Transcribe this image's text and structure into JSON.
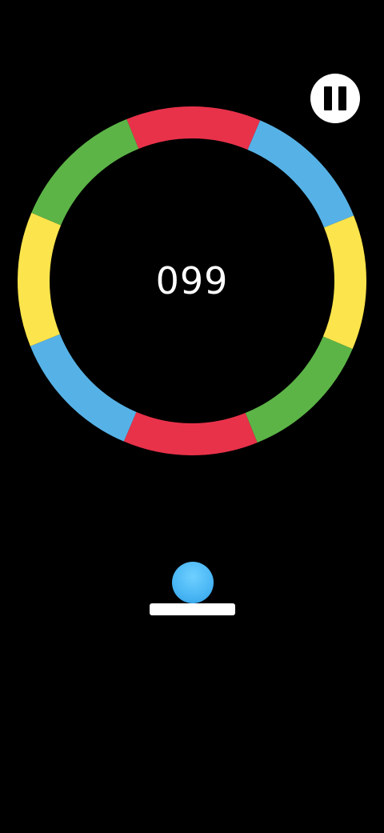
{
  "game": {
    "score": "099",
    "colors": {
      "background": "#000000",
      "red": "#e8324a",
      "blue": "#56b2e6",
      "yellow": "#fce44c",
      "green": "#5cb447",
      "ball": "#4cb8f5",
      "platform": "#ffffff"
    },
    "ring": {
      "segment_order_clockwise_from_top": [
        "red",
        "blue",
        "yellow",
        "green",
        "red",
        "blue",
        "yellow",
        "green"
      ]
    },
    "pause_icon": "pause-icon"
  }
}
